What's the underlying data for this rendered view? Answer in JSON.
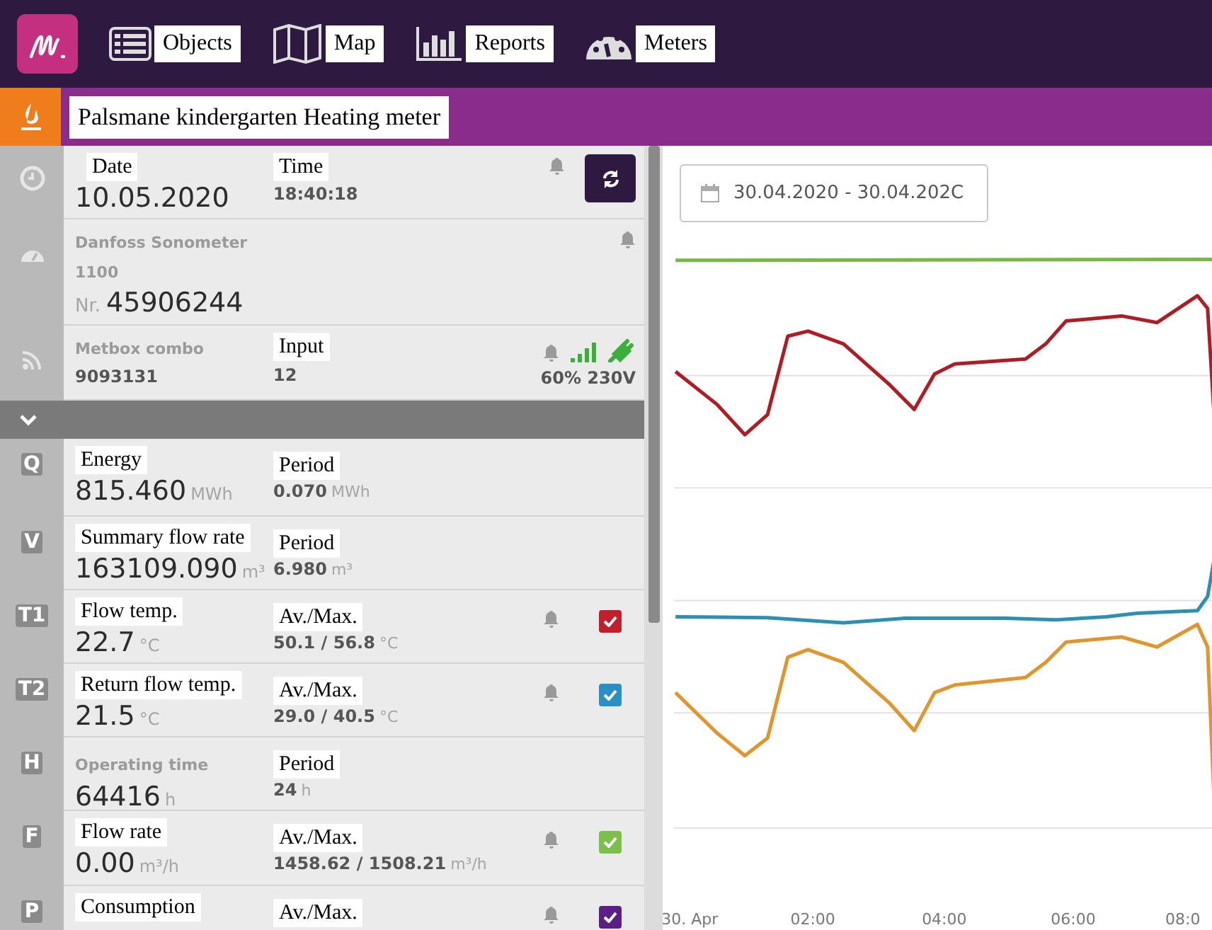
{
  "nav": {
    "items": [
      {
        "label": "Objects"
      },
      {
        "label": "Map"
      },
      {
        "label": "Reports"
      },
      {
        "label": "Meters"
      }
    ]
  },
  "title": "Palsmane kindergarten Heating meter",
  "info": {
    "date": {
      "label": "Date",
      "value": "10.05.2020"
    },
    "time": {
      "label": "Time",
      "value": "18:40:18"
    },
    "device": {
      "name": "Danfoss Sonometer",
      "model": "1100",
      "number_prefix": "Nr.",
      "number": "45906244"
    },
    "gateway": {
      "name": "Metbox combo",
      "id": "9093131",
      "input_label": "Input",
      "input": "12",
      "status": "60% 230V"
    }
  },
  "readings": [
    {
      "symbol": "Q",
      "label": "Energy",
      "label_boxed": true,
      "value": "815.460",
      "unit": "MWh",
      "aux_label": "Period",
      "aux_value": "0.070",
      "aux_unit": "MWh",
      "bell": false
    },
    {
      "symbol": "V",
      "label": "Summary flow rate",
      "label_boxed": true,
      "value": "163109.090",
      "unit": "m³",
      "aux_label": "Period",
      "aux_value": "6.980",
      "aux_unit": "m³",
      "bell": false
    },
    {
      "symbol": "T1",
      "label": "Flow temp.",
      "label_boxed": true,
      "value": "22.7",
      "unit": "°C",
      "aux_label": "Av./Max.",
      "aux_value": "50.1 / 56.8",
      "aux_unit": "°C",
      "bell": true,
      "checkbox": {
        "checked": true,
        "color": "#c21f2c"
      }
    },
    {
      "symbol": "T2",
      "label": "Return flow temp.",
      "label_boxed": true,
      "value": "21.5",
      "unit": "°C",
      "aux_label": "Av./Max.",
      "aux_value": "29.0 / 40.5",
      "aux_unit": "°C",
      "bell": true,
      "checkbox": {
        "checked": true,
        "color": "#2a8fc4"
      }
    },
    {
      "symbol": "H",
      "label": "Operating time",
      "label_boxed": false,
      "value": "64416",
      "unit": "h",
      "aux_label": "Period",
      "aux_value": "24",
      "aux_unit": "h",
      "bell": false
    },
    {
      "symbol": "F",
      "label": "Flow rate",
      "label_boxed": true,
      "value": "0.00",
      "unit": "m³/h",
      "aux_label": "Av./Max.",
      "aux_value": "1458.62 / 1508.21",
      "aux_unit": "m³/h",
      "bell": true,
      "checkbox": {
        "checked": true,
        "color": "#7cc04b"
      }
    },
    {
      "symbol": "P",
      "label": "Consumption",
      "label_boxed": true,
      "aux_label": "Av./Max.",
      "bell": true,
      "checkbox": {
        "checked": true,
        "color": "#5b1f86"
      }
    }
  ],
  "chart": {
    "date_range": "30.04.2020 - 30.04.202C",
    "x_labels": [
      "30. Apr",
      "02:00",
      "04:00",
      "06:00",
      "08:0"
    ]
  }
}
